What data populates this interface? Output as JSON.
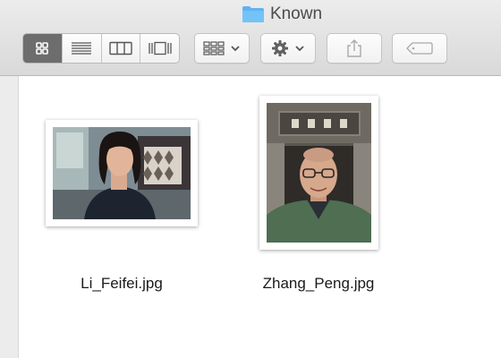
{
  "window": {
    "title": "Known",
    "folder_icon": "folder-icon"
  },
  "toolbar": {
    "view_modes": [
      {
        "name": "icon-view",
        "icon": "grid-icon",
        "active": true
      },
      {
        "name": "list-view",
        "icon": "list-icon",
        "active": false
      },
      {
        "name": "column-view",
        "icon": "columns-icon",
        "active": false
      },
      {
        "name": "gallery-view",
        "icon": "coverflow-icon",
        "active": false
      }
    ],
    "arrange_icon": "arrange-grid-icon",
    "action_icon": "gear-icon",
    "share_icon": "share-icon",
    "tag_icon": "tag-icon"
  },
  "colors": {
    "folder_blue": "#5fb3f3",
    "active_segment": "#6d6d6d",
    "toolbar_bg": "#dedede"
  },
  "files": [
    {
      "name": "Li_Feifei.jpg",
      "kind": "landscape photo"
    },
    {
      "name": "Zhang_Peng.jpg",
      "kind": "portrait photo"
    }
  ]
}
